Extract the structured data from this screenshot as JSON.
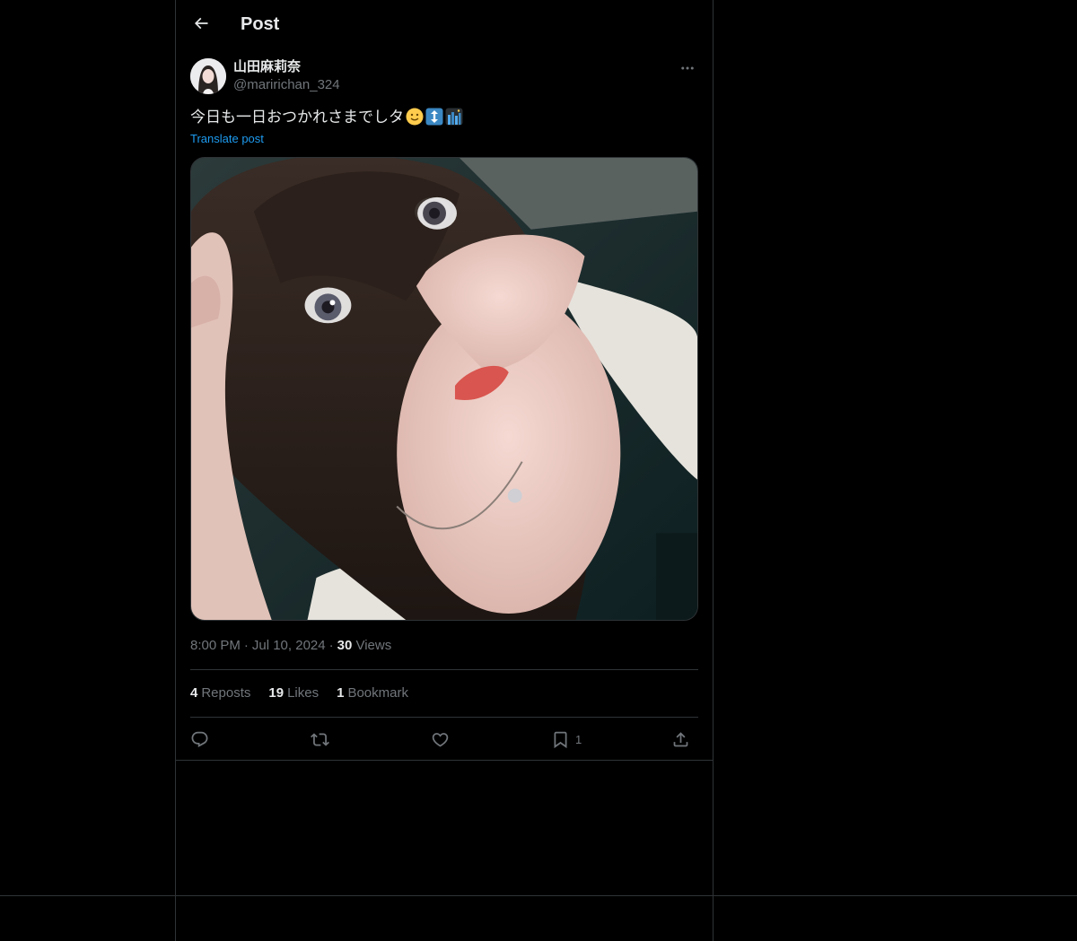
{
  "header": {
    "title": "Post"
  },
  "author": {
    "display_name": "山田麻莉奈",
    "handle": "@maririchan_324"
  },
  "post": {
    "text": "今日も一日おつかれさまでしタ",
    "emojis": [
      "slightly-smiling-face-icon",
      "up-down-arrow-icon",
      "night-city-icon"
    ],
    "translate_label": "Translate post"
  },
  "meta": {
    "time": "8:00 PM",
    "date": "Jul 10, 2024",
    "views_count": "30",
    "views_label": "Views"
  },
  "stats": {
    "reposts_count": "4",
    "reposts_label": "Reposts",
    "likes_count": "19",
    "likes_label": "Likes",
    "bookmarks_count": "1",
    "bookmarks_label": "Bookmark"
  },
  "actions": {
    "bookmark_count": "1"
  },
  "colors": {
    "background": "#000000",
    "text": "#e7e9ea",
    "secondary_text": "#71767b",
    "link": "#1d9bf0",
    "border": "#2f3336"
  }
}
